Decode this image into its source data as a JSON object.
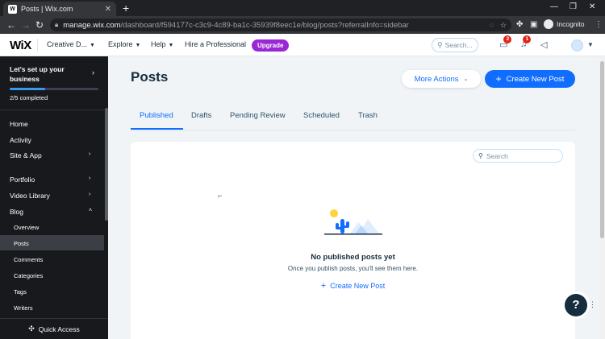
{
  "browser": {
    "tab_title": "Posts | Wix.com",
    "url_host": "manage.wix.com",
    "url_path": "/dashboard/f594177c-c3c9-4c89-ba1c-35939f8eec1e/blog/posts?referralInfo=sidebar",
    "profile_label": "Incognito"
  },
  "topbar": {
    "logo": "WiX",
    "site_name": "Creative D...",
    "explore": "Explore",
    "help": "Help",
    "hire": "Hire a Professional",
    "upgrade": "Upgrade",
    "search_placeholder": "Search...",
    "messages_badge": "2",
    "notifications_badge": "1"
  },
  "sidebar": {
    "setup_title": "Let's set up your business",
    "setup_progress_text": "2/5 completed",
    "setup_progress_fraction": 0.4,
    "items": [
      {
        "label": "Home"
      },
      {
        "label": "Activity"
      },
      {
        "label": "Site & App"
      },
      {
        "label": "Portfolio"
      },
      {
        "label": "Video Library"
      },
      {
        "label": "Blog"
      }
    ],
    "blog_sub": [
      {
        "label": "Overview"
      },
      {
        "label": "Posts"
      },
      {
        "label": "Comments"
      },
      {
        "label": "Categories"
      },
      {
        "label": "Tags"
      },
      {
        "label": "Writers"
      }
    ],
    "quick_access": "Quick Access"
  },
  "main": {
    "title": "Posts",
    "more_actions": "More Actions",
    "create_post": "Create New Post",
    "tabs": [
      {
        "label": "Published",
        "active": true
      },
      {
        "label": "Drafts"
      },
      {
        "label": "Pending Review"
      },
      {
        "label": "Scheduled"
      },
      {
        "label": "Trash"
      }
    ],
    "search_placeholder": "Search",
    "empty_title": "No published posts yet",
    "empty_sub": "Once you publish posts, you'll see them here.",
    "empty_link": "Create New Post"
  },
  "colors": {
    "accent": "#116dff",
    "upgrade": "#9a27d5",
    "sidebar_bg": "#17191c"
  }
}
